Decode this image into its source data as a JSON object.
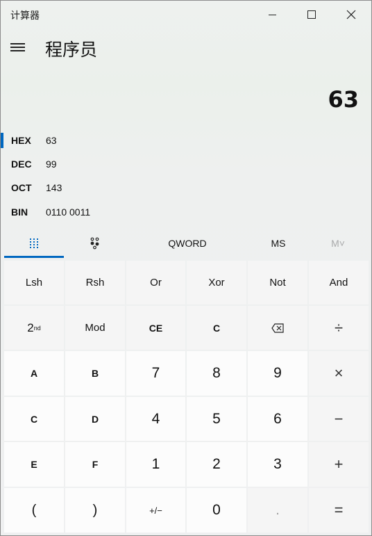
{
  "window": {
    "title": "计算器"
  },
  "header": {
    "mode": "程序员",
    "display_value": "63"
  },
  "radix": [
    {
      "name": "HEX",
      "value": "63",
      "active": true
    },
    {
      "name": "DEC",
      "value": "99",
      "active": false
    },
    {
      "name": "OCT",
      "value": "143",
      "active": false
    },
    {
      "name": "BIN",
      "value": "0110 0011",
      "active": false
    }
  ],
  "tabs": {
    "word_size": "QWORD",
    "memory_store": "MS",
    "memory_list": "M˅"
  },
  "keys": {
    "row1": [
      "Lsh",
      "Rsh",
      "Or",
      "Xor",
      "Not",
      "And"
    ],
    "second_base": "2",
    "second_sup": "nd",
    "mod": "Mod",
    "ce": "CE",
    "c": "C",
    "backspace_icon": "backspace-icon",
    "divide": "÷",
    "hex_a": "A",
    "hex_b": "B",
    "hex_c": "C",
    "hex_d": "D",
    "hex_e": "E",
    "hex_f": "F",
    "n7": "7",
    "n8": "8",
    "n9": "9",
    "n4": "4",
    "n5": "5",
    "n6": "6",
    "n1": "1",
    "n2": "2",
    "n3": "3",
    "n0": "0",
    "multiply": "×",
    "minus": "−",
    "plus": "+",
    "equals": "=",
    "open_paren": "(",
    "close_paren": ")",
    "negate": "+/−",
    "decimal": "."
  },
  "colors": {
    "accent": "#0067c0"
  }
}
